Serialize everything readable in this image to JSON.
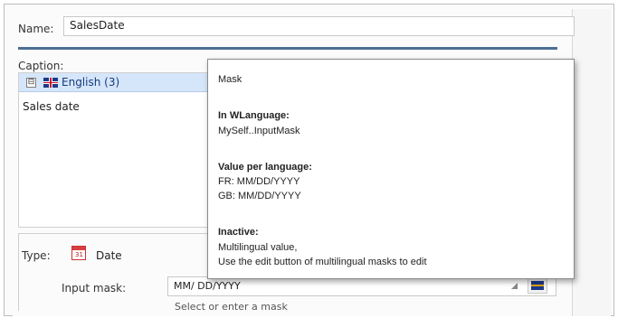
{
  "name_field": {
    "label": "Name:",
    "value": "SalesDate"
  },
  "caption": {
    "label": "Caption:",
    "language_row": {
      "collapse_symbol": "⊟",
      "flag_icon": "uk-flag-icon",
      "label": "English (3)"
    },
    "text": "Sales date"
  },
  "type": {
    "label": "Type:",
    "icon": "calendar-icon",
    "icon_number": "31",
    "value": "Date"
  },
  "input_mask": {
    "label": "Input mask:",
    "value": "MM/ DD/YYYY",
    "hint": "Select or enter a mask"
  },
  "tooltip": {
    "title": "Mask",
    "wlanguage_heading": "In WLanguage:",
    "wlanguage_value": "MySelf..InputMask",
    "per_language_heading": "Value per language:",
    "per_language_fr": "FR: MM/DD/YYYY",
    "per_language_gb": "GB: MM/DD/YYYY",
    "inactive_heading": "Inactive:",
    "inactive_line1": "Multilingual value,",
    "inactive_line2": "Use the edit button of multilingual masks to edit"
  },
  "colors": {
    "separator": "#4b6f93",
    "language_row": "#d6e6fa",
    "language_text": "#153a7a"
  }
}
